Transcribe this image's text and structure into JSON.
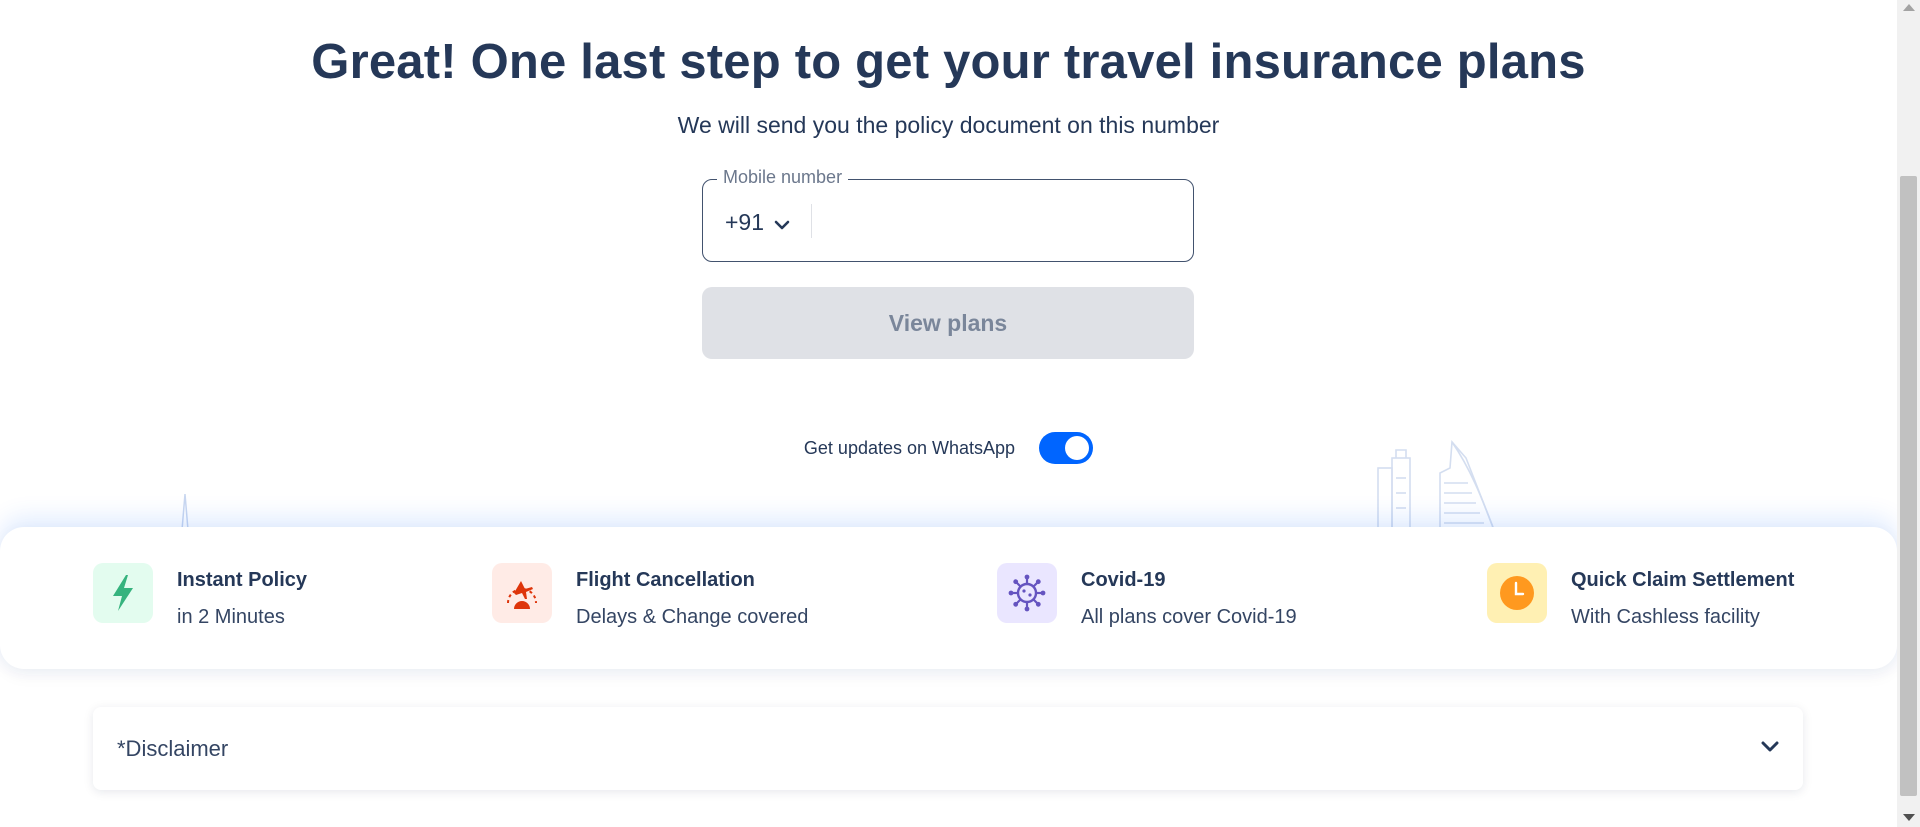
{
  "header": {
    "title": "Great! One last step to get your travel insurance plans",
    "subtitle": "We will send you the policy document on this number"
  },
  "form": {
    "mobile_label": "Mobile number",
    "country_code": "+91",
    "mobile_value": "",
    "mobile_placeholder": "",
    "submit_label": "View plans"
  },
  "whatsapp": {
    "label": "Get updates on WhatsApp",
    "enabled": true
  },
  "features": [
    {
      "title": "Instant Policy",
      "subtitle": "in 2 Minutes",
      "icon": "lightning-icon",
      "icon_bg": "#e3fcef",
      "icon_color": "#36b37e"
    },
    {
      "title": "Flight Cancellation",
      "subtitle": "Delays & Change covered",
      "icon": "flight-cancel-icon",
      "icon_bg": "#ffebe6",
      "icon_color": "#de350b"
    },
    {
      "title": "Covid-19",
      "subtitle": "All plans cover Covid-19",
      "icon": "virus-icon",
      "icon_bg": "#eae6ff",
      "icon_color": "#6554c0"
    },
    {
      "title": "Quick Claim Settlement",
      "subtitle": "With Cashless facility",
      "icon": "clock-icon",
      "icon_bg": "#fff0b3",
      "icon_color": "#ff991f"
    }
  ],
  "disclaimer": {
    "label": "*Disclaimer"
  },
  "colors": {
    "primary": "#0065ff",
    "text": "#253858",
    "disabled_bg": "#dfe1e6",
    "disabled_text": "#7a869a"
  }
}
